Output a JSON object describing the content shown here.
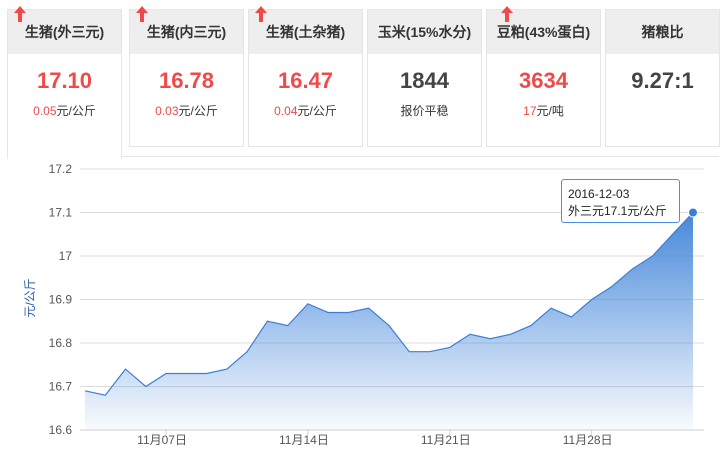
{
  "cards": [
    {
      "title": "生猪(外三元)",
      "value": "17.10",
      "change": "0.05",
      "unit": "元/公斤",
      "arrow": "up"
    },
    {
      "title": "生猪(内三元)",
      "value": "16.78",
      "change": "0.03",
      "unit": "元/公斤",
      "arrow": "up"
    },
    {
      "title": "生猪(土杂猪)",
      "value": "16.47",
      "change": "0.04",
      "unit": "元/公斤",
      "arrow": "up"
    },
    {
      "title": "玉米(15%水分)",
      "value": "1844",
      "note": "报价平稳"
    },
    {
      "title": "豆粕(43%蛋白)",
      "value": "3634",
      "change": "17",
      "unit": "元/吨",
      "arrow": "up"
    },
    {
      "title": "猪粮比",
      "value": "9.27:1"
    }
  ],
  "tooltip": {
    "date": "2016-12-03",
    "text": "外三元17.1元/公斤"
  },
  "colors": {
    "accent": "#ef4a4a",
    "line": "#3b7fd4",
    "area_top": "#5b9be6"
  },
  "chart_data": {
    "type": "area",
    "ylabel": "元/公斤",
    "ylim": [
      16.6,
      17.2
    ],
    "yticks": [
      "16.6",
      "16.7",
      "16.8",
      "16.9",
      "17",
      "17.1",
      "17.2"
    ],
    "x": [
      "2016-11-03",
      "2016-11-04",
      "2016-11-05",
      "2016-11-06",
      "2016-11-07",
      "2016-11-08",
      "2016-11-09",
      "2016-11-10",
      "2016-11-11",
      "2016-11-12",
      "2016-11-13",
      "2016-11-14",
      "2016-11-15",
      "2016-11-16",
      "2016-11-17",
      "2016-11-18",
      "2016-11-19",
      "2016-11-20",
      "2016-11-21",
      "2016-11-22",
      "2016-11-23",
      "2016-11-24",
      "2016-11-25",
      "2016-11-26",
      "2016-11-27",
      "2016-11-28",
      "2016-11-29",
      "2016-11-30",
      "2016-12-01",
      "2016-12-02",
      "2016-12-03"
    ],
    "values": [
      16.69,
      16.68,
      16.74,
      16.7,
      16.73,
      16.73,
      16.73,
      16.74,
      16.78,
      16.85,
      16.84,
      16.89,
      16.87,
      16.87,
      16.88,
      16.84,
      16.78,
      16.78,
      16.79,
      16.82,
      16.81,
      16.82,
      16.84,
      16.88,
      16.86,
      16.9,
      16.93,
      16.97,
      17.0,
      17.05,
      17.1
    ],
    "xtick_labels": [
      "11月07日",
      "11月14日",
      "11月21日",
      "11月28日"
    ],
    "grid": true,
    "legend": "none"
  }
}
